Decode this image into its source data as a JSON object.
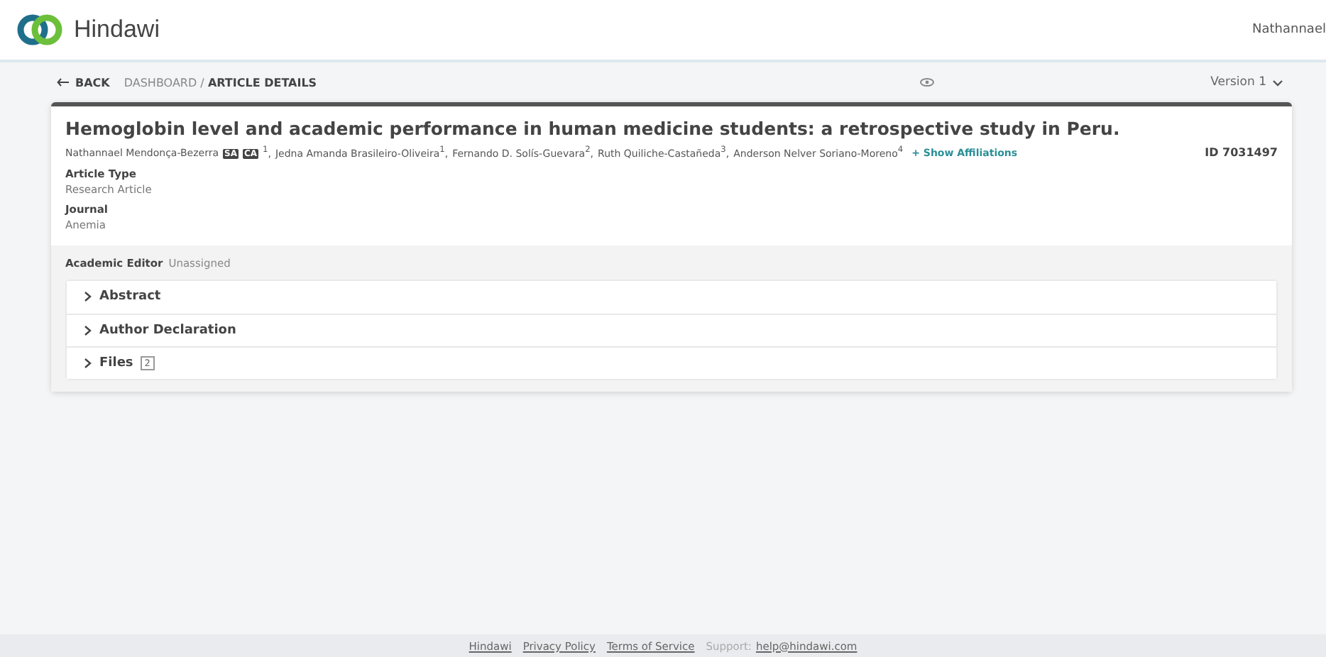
{
  "header": {
    "brand": "Hindawi",
    "user": "Nathannael"
  },
  "nav": {
    "back": "BACK",
    "breadcrumb": "DASHBOARD /",
    "current": "ARTICLE DETAILS",
    "version": "Version 1"
  },
  "article": {
    "title": "Hemoglobin level and academic performance in human medicine students: a retrospective study in Peru.",
    "authors": [
      {
        "name": "Nathannael Mendonça-Bezerra",
        "badges": [
          "SA",
          "CA"
        ],
        "note": "$^{1}$,"
      },
      {
        "name": "Jedna Amanda Brasileiro-Oliveira",
        "note": "$^{1}$,"
      },
      {
        "name": "Fernando D. Solís-Guevara",
        "note": "$^{2}$,"
      },
      {
        "name": "Ruth Quiliche-Castañeda",
        "note": "$^{3}$,"
      },
      {
        "name": "Anderson Nelver Soriano-Moreno",
        "note": "$^{4}$"
      }
    ],
    "show_affiliations": "+ Show Affiliations",
    "id": "ID 7031497",
    "fields": [
      {
        "label": "Article Type",
        "value": "Research Article"
      },
      {
        "label": "Journal",
        "value": "Anemia"
      }
    ]
  },
  "editor": {
    "label": "Academic Editor",
    "value": "Unassigned"
  },
  "sections": [
    {
      "title": "Abstract",
      "expanded": false
    },
    {
      "title": "Author Declaration",
      "expanded": false
    },
    {
      "title": "Files",
      "count": "2",
      "expanded": false
    }
  ],
  "footer": {
    "links": [
      "Hindawi",
      "Privacy Policy",
      "Terms of Service"
    ],
    "support_label": "Support:",
    "email": "help@hindawi.com"
  }
}
